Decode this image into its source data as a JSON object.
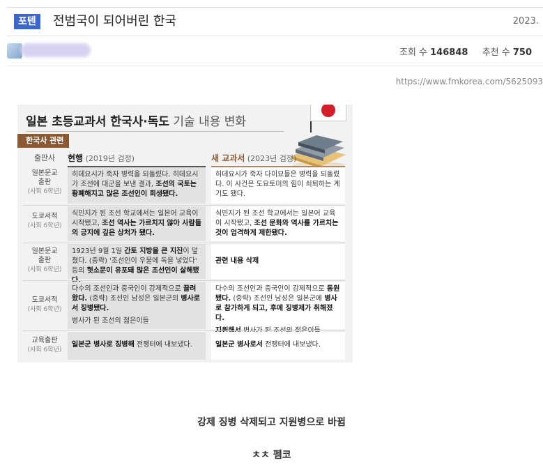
{
  "post": {
    "badge": "포텐",
    "title": "전범국이 되어버린 한국",
    "date": "2023.",
    "views_label": "조회 수",
    "views": "146848",
    "recommend_label": "추천 수",
    "recommend": "750",
    "source_url": "https://www.fmkorea.com/5625093"
  },
  "card": {
    "title_strong": "일본 초등교과서 한국사·독도",
    "title_light": " 기술 내용 변화",
    "category": "한국사 관련",
    "col_publisher": "출판사",
    "col_current": "현행",
    "col_current_note": " (2019년 검정)",
    "col_new": "새 교과서",
    "col_new_note": " (2023년 검정)",
    "rows": [
      {
        "publisher": "일본문교",
        "publisher2": "출판",
        "grade": "(사회 6학년)",
        "current_plain": "히데요시가 죽자 병력을 되돌렸다. 히데요시가 조선에 대군을 보낸 결과, ",
        "current_bold": "조선의 국토는 황폐해지고 많은 조선인이 희생됐다.",
        "new_plain": "히데요시가 죽자 다이묘들은 병력을 되돌렸다. 이 사건은 도요토미의 힘이 쇠퇴하는 계기도 됐다.",
        "new_bold": ""
      },
      {
        "publisher": "도쿄서적",
        "publisher2": "",
        "grade": "(사회 6학년)",
        "current_plain": "식민지가 된 조선 학교에서는 일본어 교육이 시작됐고, ",
        "current_bold": "조선 역사는 가르치지 않아 사람들의 긍지에 깊은 상처가 됐다.",
        "new_plain": "식민지가 된 조선 학교에서는 일본어 교육이 시작됐고, ",
        "new_bold": "조선 문화와 역사를 가르치는 것이 엄격하게 제한됐다."
      },
      {
        "publisher": "일본문교",
        "publisher2": "출판",
        "grade": "(사회 6학년)",
        "current_plain": "1923년 9월 1일 ",
        "current_bold": "간토 지방을 큰 지진",
        "current_plain2": "이 덮쳤다. (중략) '조선인이 우물에 독을 넣었다' 등의 ",
        "current_bold2": "헛소문이 유포돼 많은 조선인이 살해됐다.",
        "new_plain": "",
        "new_bold": "관련 내용 삭제"
      },
      {
        "publisher": "도쿄서적",
        "publisher2": "",
        "grade": "(사회 6학년)",
        "current_plain": "다수의 조선인과 중국인이 강제적으로 ",
        "current_bold": "끌려왔다.",
        "current_plain2": " (중략) 조선인 남성은 일본군의 ",
        "current_bold2": "병사로서 징병됐다.",
        "current_extra": "병사가 된 조선의 젊은이들",
        "new_plain": "다수의 조선인과 중국인이 강제적으로 ",
        "new_bold": "동원됐다.",
        "new_plain2": " (중략) 조선인 남성은 일본군에 ",
        "new_bold2": "병사로 참가하게 되고, 후에 징병제가 취해졌다.",
        "new_extra_bold": "지원해서",
        "new_extra": " 병사가 된 조선의 젊은이들"
      },
      {
        "publisher": "교육출판",
        "publisher2": "",
        "grade": "(사회 6학년)",
        "current_plain": "",
        "current_bold": "일본군 병사로 징병해",
        "current_plain2": " 전쟁터에 내보냈다.",
        "new_plain": "",
        "new_bold": "일본군 병사로서",
        "new_plain2": " 전쟁터에 내보냈다."
      }
    ]
  },
  "caption": "강제 징병 삭제되고 지원병으로 바뀜",
  "caption2": "ㅊㅊ 펨코",
  "icons": {
    "avatar": "avatar-icon",
    "flag": "japan-flag-icon",
    "books": "books-icon"
  },
  "colors": {
    "badge": "#3d67c8",
    "category": "#8a5a35",
    "flag_sun": "#d21e2b"
  }
}
